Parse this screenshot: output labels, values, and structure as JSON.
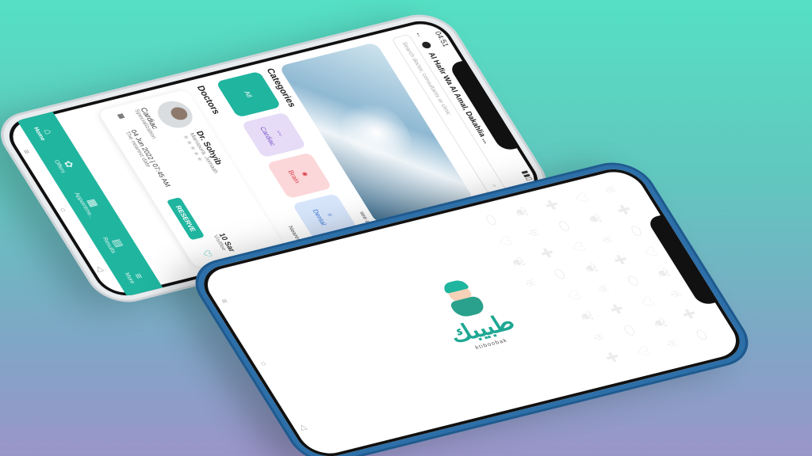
{
  "phone1": {
    "status": {
      "time": "04:51"
    },
    "header": {
      "location": "Al Hafir Wa Al Amal, Dakahlia ...",
      "search_placeholder": "Search doctor, consultants or clinic"
    },
    "categories": {
      "title": "Categories",
      "see_all": "see all",
      "items": [
        {
          "label": "All"
        },
        {
          "label": "Cardiac"
        },
        {
          "label": "Brain"
        },
        {
          "label": "Dental"
        }
      ]
    },
    "doctors": {
      "title": "Doctors",
      "sort_label": "Nearest",
      "card": {
        "name": "Dr. Sohyib",
        "subtitle": "Mansoura, Jomaah",
        "stars": "★★★★★",
        "specialty": "Cardiac",
        "specialty_sub": "Specialization",
        "price": "10 Sar",
        "price_sub": "Visitfee",
        "datetime": "04 Jun 2022 | 07:45 AM",
        "datetime_sub": "The nearest date",
        "reserve_label": "RESERVE"
      }
    },
    "bottom_nav": [
      {
        "label": "Home",
        "icon": "home-icon",
        "glyph": "⌂",
        "active": true
      },
      {
        "label": "Offers",
        "icon": "offers-icon",
        "glyph": "✿",
        "active": false
      },
      {
        "label": "Appointme..",
        "icon": "calendar-icon",
        "glyph": "▦",
        "active": false
      },
      {
        "label": "Results",
        "icon": "results-icon",
        "glyph": "▤",
        "active": false
      },
      {
        "label": "More",
        "icon": "menu-icon",
        "glyph": "≡",
        "active": false
      }
    ],
    "system_nav": {
      "recent": "≡",
      "home": "○",
      "back": "◁"
    }
  },
  "phone2": {
    "brand": {
      "arabic": "طبيبك",
      "english": "ktiboobak"
    },
    "system_nav": {
      "recent": "≡",
      "home": "○",
      "back": "◁"
    }
  },
  "colors": {
    "accent": "#20b59f",
    "frame_blue": "#2d6fa8"
  }
}
